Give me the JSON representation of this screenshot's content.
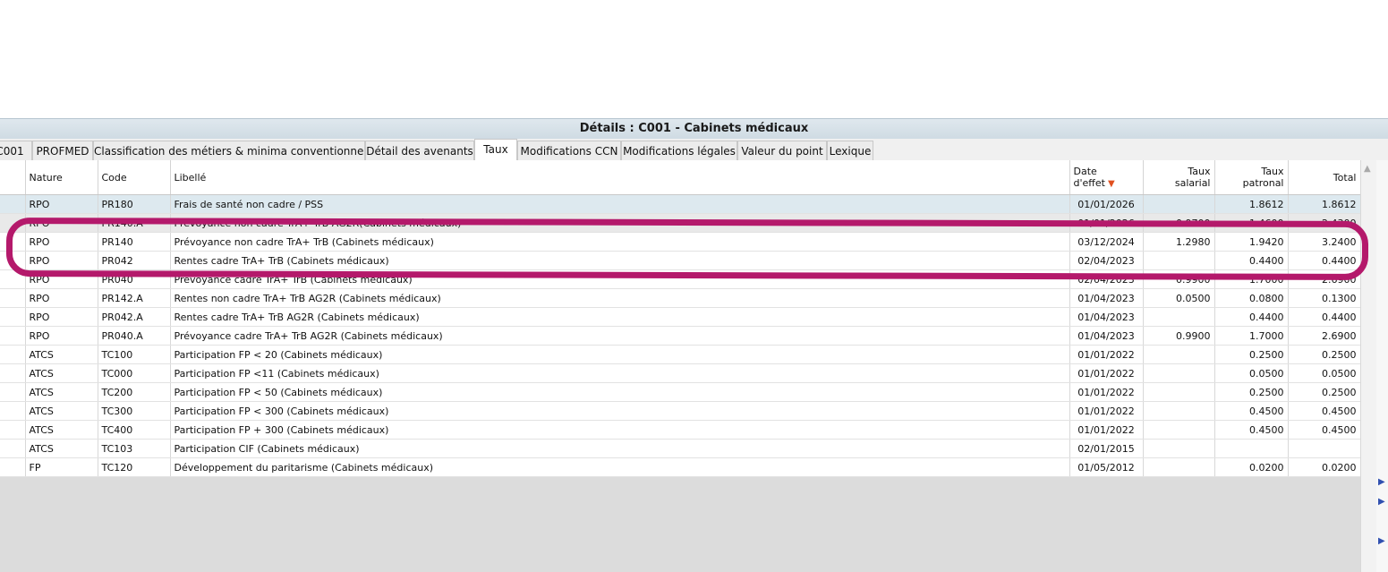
{
  "window": {
    "title": "Détails : C001 - Cabinets médicaux"
  },
  "tabs": [
    {
      "label": "C001",
      "active": false
    },
    {
      "label": "PROFMED",
      "active": false
    },
    {
      "label": "Classification des métiers & minima conventionnels",
      "active": false
    },
    {
      "label": "Détail des avenants",
      "active": false
    },
    {
      "label": "Taux",
      "active": true
    },
    {
      "label": "Modifications CCN",
      "active": false
    },
    {
      "label": "Modifications légales",
      "active": false
    },
    {
      "label": "Valeur du point",
      "active": false
    },
    {
      "label": "Lexique",
      "active": false
    }
  ],
  "grid": {
    "headers": {
      "nature": "Nature",
      "code": "Code",
      "libelle": "Libellé",
      "date_effet": "Date d'effet",
      "taux_salarial_1": "Taux",
      "taux_salarial_2": "salarial",
      "taux_patronal_1": "Taux",
      "taux_patronal_2": "patronal",
      "total": "Total"
    },
    "sort_icon": "sort-descending-icon",
    "rows": [
      {
        "nature": "RPO",
        "code": "PR180",
        "libelle": "Frais de santé non cadre / PSS",
        "date": "01/01/2026",
        "salarial": "",
        "patronal": "1.8612",
        "total": "1.8612"
      },
      {
        "nature": "RPO",
        "code": "PR140.A",
        "libelle": "Prévoyance non cadre TrA+ TrB AG2R(Cabinets médicaux)",
        "date": "01/01/2026",
        "salarial": "0.9700",
        "patronal": "1.4600",
        "total": "2.4300"
      },
      {
        "nature": "RPO",
        "code": "PR140",
        "libelle": "Prévoyance non cadre TrA+ TrB (Cabinets médicaux)",
        "date": "03/12/2024",
        "salarial": "1.2980",
        "patronal": "1.9420",
        "total": "3.2400"
      },
      {
        "nature": "RPO",
        "code": "PR042",
        "libelle": "Rentes cadre TrA+ TrB (Cabinets médicaux)",
        "date": "02/04/2023",
        "salarial": "",
        "patronal": "0.4400",
        "total": "0.4400"
      },
      {
        "nature": "RPO",
        "code": "PR040",
        "libelle": "Prévoyance cadre TrA+ TrB (Cabinets médicaux)",
        "date": "02/04/2023",
        "salarial": "0.9900",
        "patronal": "1.7000",
        "total": "2.6900"
      },
      {
        "nature": "RPO",
        "code": "PR142.A",
        "libelle": "Rentes non cadre TrA+ TrB AG2R (Cabinets médicaux)",
        "date": "01/04/2023",
        "salarial": "0.0500",
        "patronal": "0.0800",
        "total": "0.1300"
      },
      {
        "nature": "RPO",
        "code": "PR042.A",
        "libelle": "Rentes cadre TrA+ TrB AG2R (Cabinets médicaux)",
        "date": "01/04/2023",
        "salarial": "",
        "patronal": "0.4400",
        "total": "0.4400"
      },
      {
        "nature": "RPO",
        "code": "PR040.A",
        "libelle": "Prévoyance cadre TrA+ TrB AG2R (Cabinets médicaux)",
        "date": "01/04/2023",
        "salarial": "0.9900",
        "patronal": "1.7000",
        "total": "2.6900"
      },
      {
        "nature": "ATCS",
        "code": "TC100",
        "libelle": "Participation FP < 20 (Cabinets médicaux)",
        "date": "01/01/2022",
        "salarial": "",
        "patronal": "0.2500",
        "total": "0.2500"
      },
      {
        "nature": "ATCS",
        "code": "TC000",
        "libelle": "Participation FP <11 (Cabinets médicaux)",
        "date": "01/01/2022",
        "salarial": "",
        "patronal": "0.0500",
        "total": "0.0500"
      },
      {
        "nature": "ATCS",
        "code": "TC200",
        "libelle": "Participation FP < 50 (Cabinets médicaux)",
        "date": "01/01/2022",
        "salarial": "",
        "patronal": "0.2500",
        "total": "0.2500"
      },
      {
        "nature": "ATCS",
        "code": "TC300",
        "libelle": "Participation FP < 300 (Cabinets médicaux)",
        "date": "01/01/2022",
        "salarial": "",
        "patronal": "0.4500",
        "total": "0.4500"
      },
      {
        "nature": "ATCS",
        "code": "TC400",
        "libelle": "Participation FP + 300 (Cabinets médicaux)",
        "date": "01/01/2022",
        "salarial": "",
        "patronal": "0.4500",
        "total": "0.4500"
      },
      {
        "nature": "ATCS",
        "code": "TC103",
        "libelle": "Participation CIF (Cabinets médicaux)",
        "date": "02/01/2015",
        "salarial": "",
        "patronal": "",
        "total": ""
      },
      {
        "nature": "FP",
        "code": "TC120",
        "libelle": "Développement du paritarisme (Cabinets médicaux)",
        "date": "01/05/2012",
        "salarial": "",
        "patronal": "0.0200",
        "total": "0.0200"
      }
    ]
  }
}
